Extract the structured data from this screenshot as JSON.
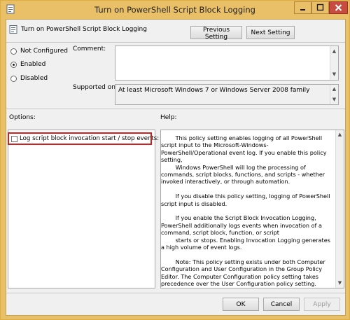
{
  "window": {
    "title": "Turn on PowerShell Script Block Logging",
    "controls": {
      "minimize": "minimize",
      "maximize": "maximize",
      "close": "close"
    }
  },
  "header": {
    "policy_name": "Turn on PowerShell Script Block Logging",
    "previous_setting_label": "Previous Setting",
    "next_setting_label": "Next Setting"
  },
  "state": {
    "not_configured_label": "Not Configured",
    "enabled_label": "Enabled",
    "disabled_label": "Disabled",
    "selected": "Enabled"
  },
  "comment": {
    "label": "Comment:",
    "value": ""
  },
  "supported": {
    "label": "Supported on:",
    "value": "At least Microsoft Windows 7 or Windows Server 2008 family"
  },
  "options": {
    "header": "Options:",
    "checkbox_label": "Log script block invocation start / stop events:",
    "checked": false
  },
  "help": {
    "header": "Help:",
    "paragraphs": [
      "        This policy setting enables logging of all PowerShell script input to the Microsoft-Windows-PowerShell/Operational event log. If you enable this policy setting,\n        Windows PowerShell will log the processing of commands, script blocks, functions, and scripts - whether invoked interactively, or through automation.",
      "        If you disable this policy setting, logging of PowerShell script input is disabled.",
      "        If you enable the Script Block Invocation Logging, PowerShell additionally logs events when invocation of a command, script block, function, or script\n        starts or stops. Enabling Invocation Logging generates a high volume of event logs.",
      "        Note: This policy setting exists under both Computer Configuration and User Configuration in the Group Policy Editor. The Computer Configuration policy setting takes precedence over the User Configuration policy setting."
    ]
  },
  "footer": {
    "ok_label": "OK",
    "cancel_label": "Cancel",
    "apply_label": "Apply"
  },
  "icons": {
    "app": "policy-icon",
    "policy": "policy-setting-icon"
  },
  "colors": {
    "titlebar": "#e9bf67",
    "close_button": "#c74b3f",
    "highlight": "#d22020"
  }
}
